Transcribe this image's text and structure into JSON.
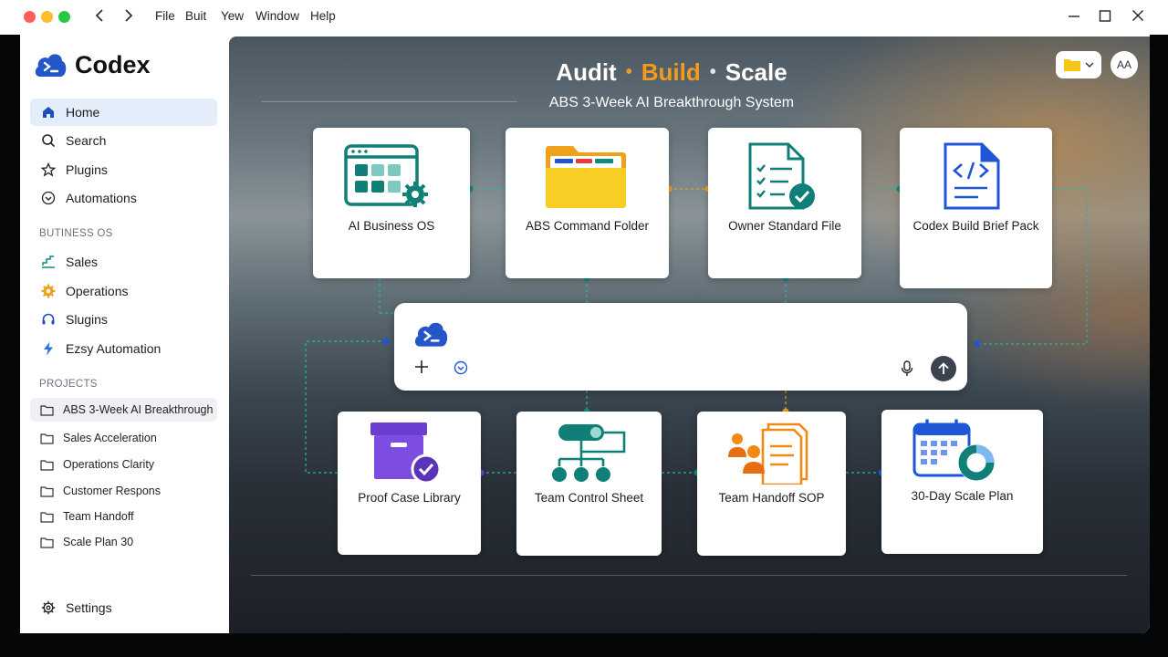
{
  "menu": [
    "File",
    "Buit",
    "Yew",
    "Window",
    "Help"
  ],
  "app": {
    "name": "Codex"
  },
  "sidebar": {
    "nav": [
      {
        "label": "Home"
      },
      {
        "label": "Search"
      },
      {
        "label": "Plugins"
      },
      {
        "label": "Automations"
      }
    ],
    "section1": "BUTINESS OS",
    "business": [
      {
        "label": "Sales"
      },
      {
        "label": "Operations"
      },
      {
        "label": "Slugins"
      },
      {
        "label": "Ezsy Automation"
      }
    ],
    "section2": "PROJECTS",
    "projects": [
      {
        "label": "ABS 3-Week AI Breakthrough"
      },
      {
        "label": "Sales Acceleration"
      },
      {
        "label": "Operations Clarity"
      },
      {
        "label": "Customer Respons"
      },
      {
        "label": "Team Handoff"
      },
      {
        "label": "Scale Plan 30"
      }
    ],
    "settings": "Settings"
  },
  "hero": {
    "word1": "Audit",
    "word2": "Build",
    "word3": "Scale",
    "dot": "•",
    "subtitle": "ABS 3-Week AI Breakthrough System"
  },
  "avatar": "AA",
  "cards": {
    "top": [
      {
        "label": "AI Business OS",
        "icon": "dashboard-gear-icon"
      },
      {
        "label": "ABS Command Folder",
        "icon": "folder-icon"
      },
      {
        "label": "Owner Standard File",
        "icon": "checklist-document-icon"
      },
      {
        "label": "Codex Build Brief Pack",
        "icon": "code-document-icon"
      }
    ],
    "bottom": [
      {
        "label": "Proof Case Library",
        "icon": "archive-box-check-icon"
      },
      {
        "label": "Team Control Sheet",
        "icon": "org-chart-toggle-icon"
      },
      {
        "label": "Team Handoff SOP",
        "icon": "people-documents-icon"
      },
      {
        "label": "30-Day Scale Plan",
        "icon": "calendar-donut-icon"
      }
    ]
  },
  "colors": {
    "accent_blue": "#1a73e8",
    "accent_orange": "#f29b1d",
    "teal": "#0f8a80",
    "sidebar_active": "#e4eefb"
  }
}
